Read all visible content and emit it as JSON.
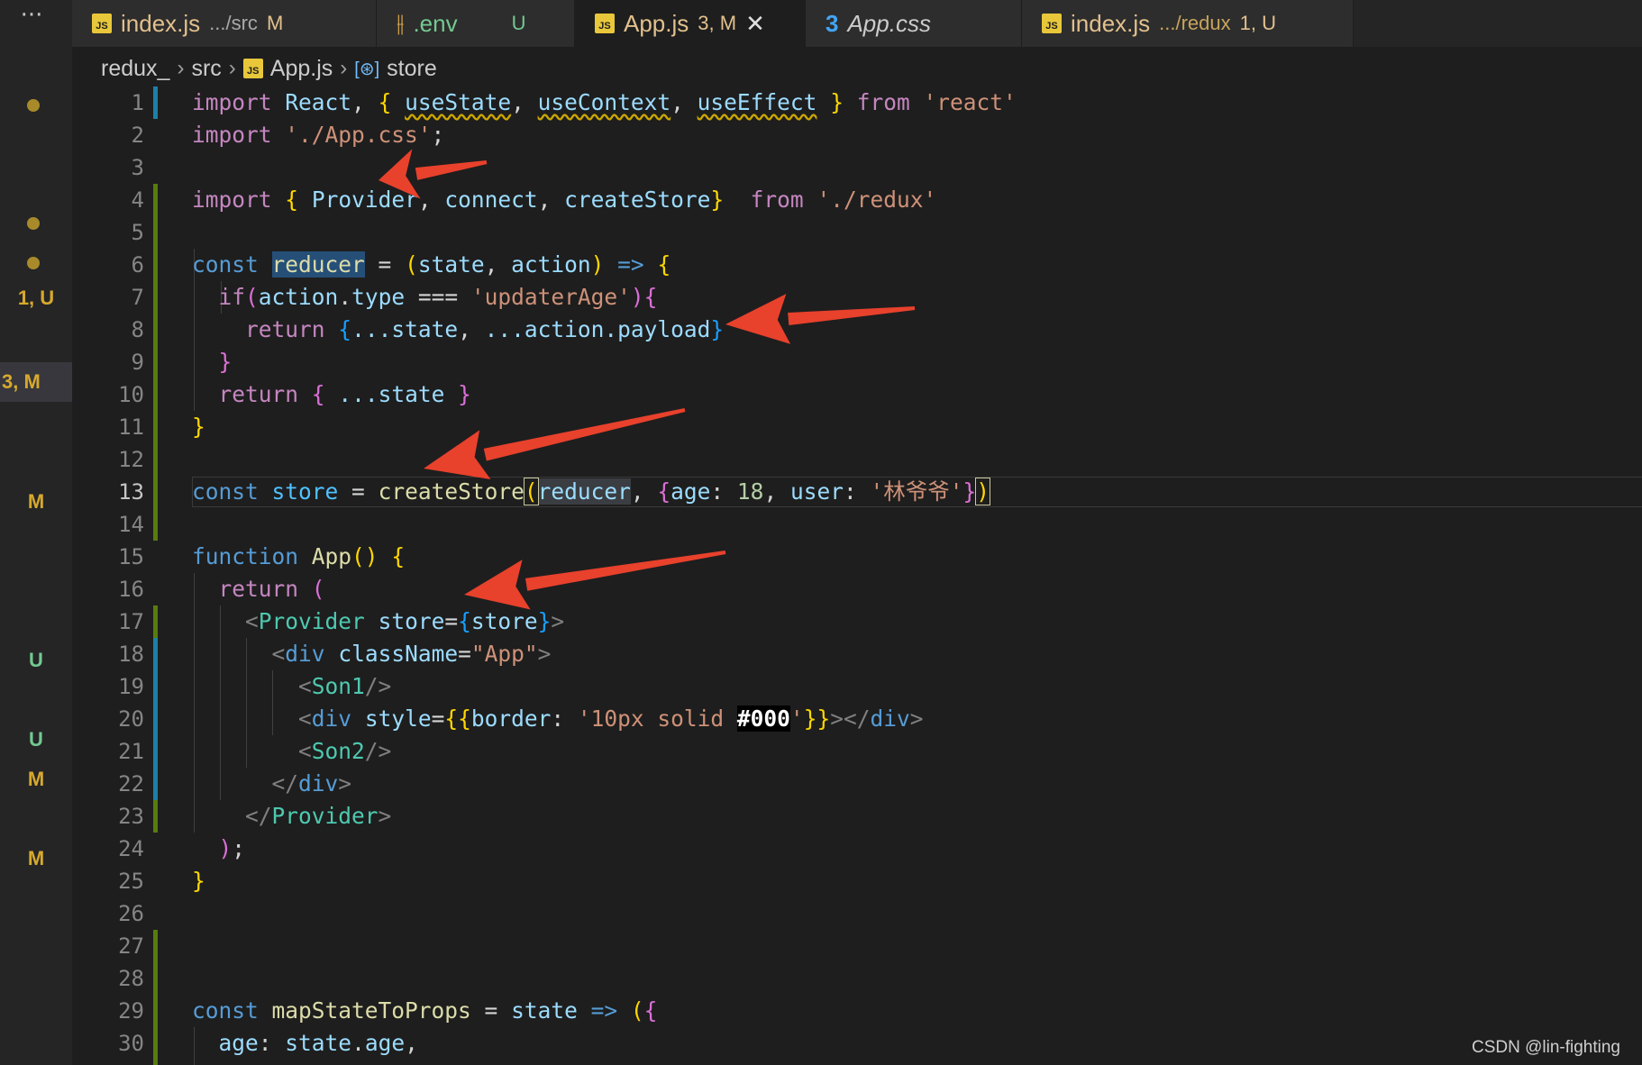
{
  "tabs": [
    {
      "name": "index.js",
      "path": ".../src",
      "status": "M"
    },
    {
      "name": ".env",
      "path": "",
      "status": "U"
    },
    {
      "name": "App.js",
      "path": "",
      "status": "3, M",
      "close": "✕"
    },
    {
      "name": "App.css",
      "path": "",
      "status": ""
    },
    {
      "name": "index.js",
      "path": ".../redux",
      "status": "1, U"
    }
  ],
  "tab_icons": {
    "js": "JS",
    "env": "⫲",
    "css": "3"
  },
  "breadcrumb": {
    "root": "redux_",
    "folder": "src",
    "file": "App.js",
    "symbol_icon": "[⊛]",
    "symbol": "store",
    "sep": "›"
  },
  "explorer": {
    "more": "···",
    "badges": [
      "1, U",
      "3, M",
      "M",
      "U",
      "U",
      "M",
      "M"
    ]
  },
  "line_numbers": [
    "1",
    "2",
    "3",
    "4",
    "5",
    "6",
    "7",
    "8",
    "9",
    "10",
    "11",
    "12",
    "13",
    "14",
    "15",
    "16",
    "17",
    "18",
    "19",
    "20",
    "21",
    "22",
    "23",
    "24",
    "25",
    "26",
    "27",
    "28",
    "29",
    "30"
  ],
  "code": {
    "l1": {
      "kw": "import",
      "react": "React",
      "usestate": "useState",
      "usecontext": "useContext",
      "useeffect": "useEffect",
      "from": "from",
      "src": "'react'"
    },
    "l2": {
      "kw": "import",
      "src": "'./App.css'"
    },
    "l4": {
      "kw": "import",
      "provider": "Provider",
      "connect": "connect",
      "createstore": "createStore",
      "from": "from",
      "src": "'./redux'"
    },
    "l6": {
      "kw": "const",
      "name": "reducer",
      "p1": "state",
      "p2": "action"
    },
    "l7": {
      "kw": "if",
      "obj": "action",
      "prop": "type",
      "op": "===",
      "str": "'updaterAge'"
    },
    "l8": {
      "kw": "return",
      "spread1": "...state",
      "spread2": "...action.payload"
    },
    "l10": {
      "kw": "return",
      "spread": "...state"
    },
    "l13": {
      "kw": "const",
      "name": "store",
      "fn": "createStore",
      "arg": "reducer",
      "k1": "age",
      "v1": "18",
      "k2": "user",
      "v2": "'林爷爷'"
    },
    "l15": {
      "kw": "function",
      "name": "App"
    },
    "l16": {
      "kw": "return"
    },
    "l17": {
      "tag": "Provider",
      "attr": "store",
      "val": "store"
    },
    "l18": {
      "tag": "div",
      "attr": "className",
      "val": "\"App\""
    },
    "l19": {
      "tag": "Son1"
    },
    "l20": {
      "tag": "div",
      "attr": "style",
      "key": "border",
      "str1": "'10px solid ",
      "hex": "#000",
      "str2": "'"
    },
    "l21": {
      "tag": "Son2"
    },
    "l22": {
      "tag": "div"
    },
    "l23": {
      "tag": "Provider"
    },
    "l29": {
      "kw": "const",
      "name": "mapStateToProps",
      "param": "state"
    },
    "l30": {
      "key": "age",
      "obj": "state",
      "prop": "age"
    }
  },
  "watermark": "CSDN @lin-fighting",
  "colors": {
    "arrow": "#e8412c",
    "accent_modified": "#e2c08d",
    "accent_untracked": "#73c991"
  }
}
